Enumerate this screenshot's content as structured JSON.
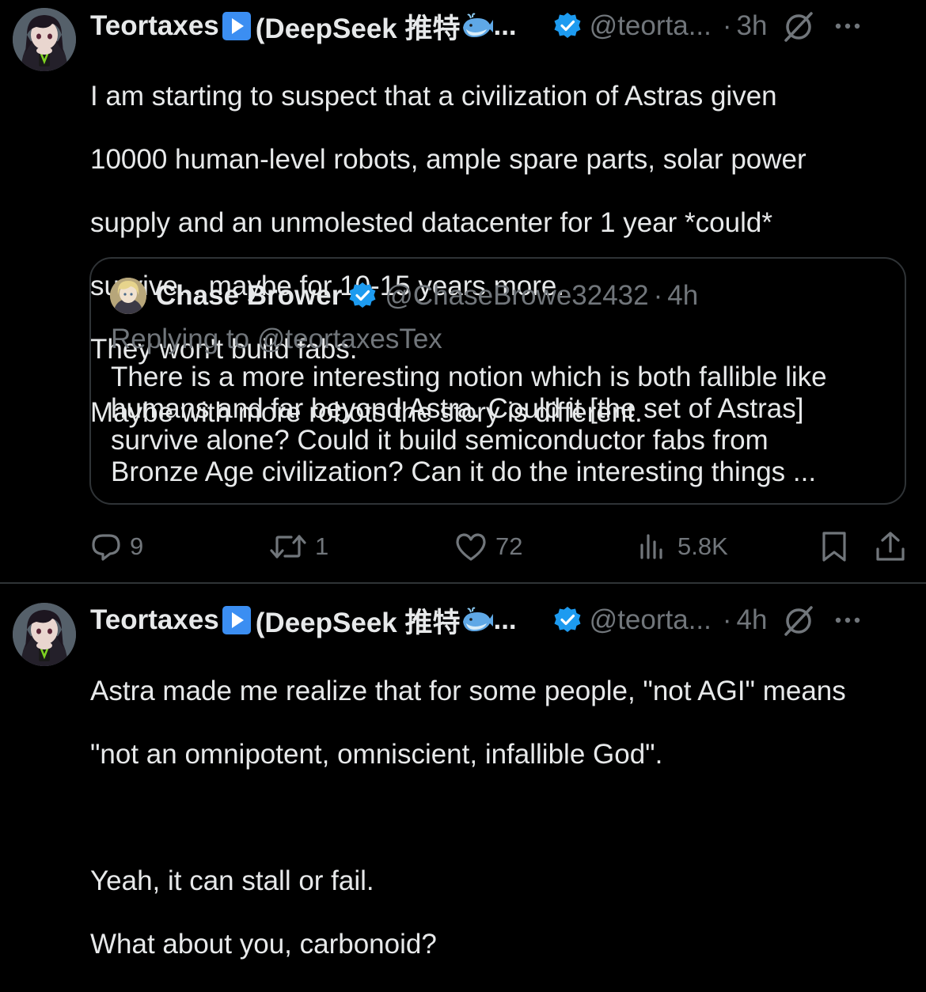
{
  "tweets": [
    {
      "author": {
        "name": "Teortaxes",
        "name_suffix": "(DeepSeek 推特",
        "name_truncation": "...",
        "handle": "@teorta...",
        "verified": true
      },
      "separator": "·",
      "time": "3h",
      "text_lines": [
        "I am starting to suspect that a civilization of Astras given",
        "10000 human-level robots, ample spare parts, solar power",
        "supply and an unmolested datacenter for 1 year *could*",
        "survive... maybe for 10-15 years more.",
        "They won't build fabs.",
        "Maybe with more robots the story is different."
      ],
      "quote": {
        "name": "Chase Brower",
        "handle": "@ChaseBrowe32432",
        "separator": "·",
        "time": "4h",
        "replying_to": "Replying to @teortaxesTex",
        "text_lines": [
          "There is a more interesting notion which is both fallible like",
          "humans and far beyond Astra. Could it [the set of Astras]",
          "survive alone? Could it build semiconductor fabs from",
          "Bronze Age civilization? Can it do the interesting things ..."
        ]
      },
      "stats": {
        "replies": "9",
        "retweets": "1",
        "likes": "72",
        "views": "5.8K"
      }
    },
    {
      "author": {
        "name": "Teortaxes",
        "name_suffix": "(DeepSeek 推特",
        "name_truncation": "...",
        "handle": "@teorta...",
        "verified": true
      },
      "separator": "·",
      "time": "4h",
      "text_lines": [
        "Astra made me realize that for some people, \"not AGI\" means",
        "\"not an omnipotent, omniscient, infallible God\".",
        "",
        "Yeah, it can stall or fail.",
        "What about you, carbonoid?"
      ]
    }
  ],
  "colors": {
    "background": "#000000",
    "text_primary": "#e7e9ea",
    "text_secondary": "#71767b",
    "verified_blue": "#1d9bf0",
    "border": "#2f3336"
  },
  "icons": {
    "reply": "speech-bubble-icon",
    "retweet": "retweet-arrows-icon",
    "like": "heart-icon",
    "views": "bar-chart-icon",
    "bookmark": "bookmark-icon",
    "share": "upload-share-icon",
    "grok": "grok-slash-circle-icon",
    "more": "three-dots-icon",
    "verified": "verified-badge-icon",
    "play": "play-button-emoji",
    "whale": "whale-emoji"
  }
}
